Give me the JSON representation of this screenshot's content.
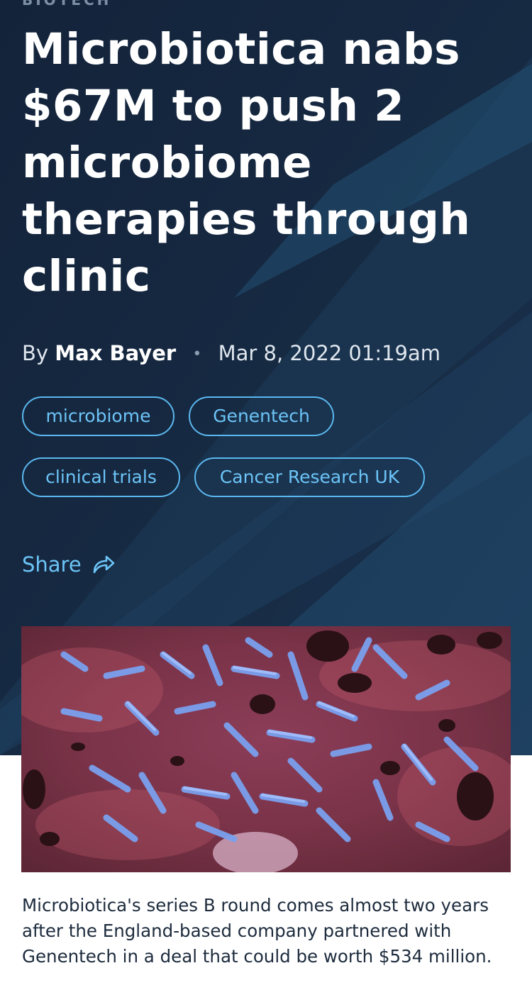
{
  "article": {
    "category": "BIOTECH",
    "title": "Microbiotica nabs $67M to push 2 microbiome therapies through clinic",
    "byline_prefix": "By",
    "author": "Max Bayer",
    "separator": "•",
    "date": "Mar 8, 2022 01:19am",
    "tags": [
      "microbiome",
      "Genentech",
      "clinical trials",
      "Cancer Research UK"
    ],
    "share_label": "Share",
    "share_icon": "share-arrow-icon",
    "image_alt": "Microscope image of blue rod-shaped bacteria on a pinkish-red surface",
    "caption": "Microbiotica's series B round comes almost two years after the England-based company partnered with Genentech in a deal that could be worth $534 million."
  },
  "colors": {
    "hero_bg": "#16263c",
    "accent": "#6cc4f7",
    "title_text": "#ffffff",
    "caption_text": "#1d2b3d"
  }
}
